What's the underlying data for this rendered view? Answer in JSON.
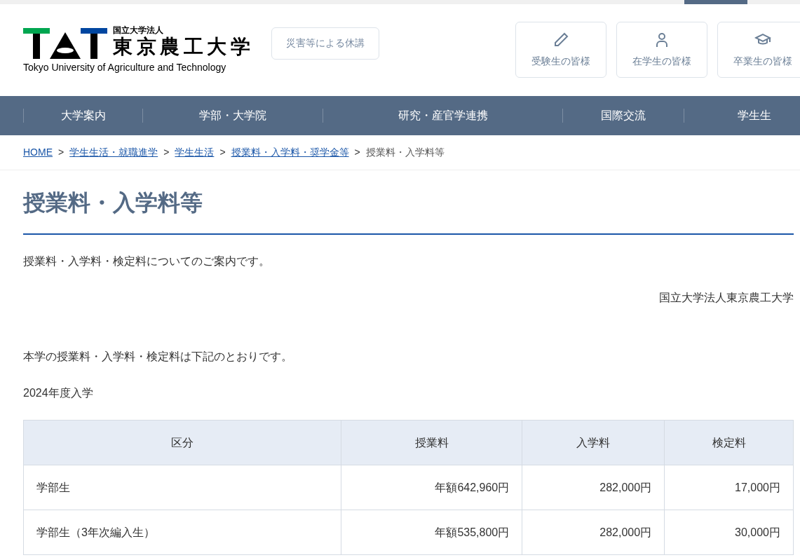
{
  "header": {
    "logo": {
      "org_type": "国立大学法人",
      "name": "東京農工大学",
      "name_en": "Tokyo University of Agriculture and Technology"
    },
    "notice_button": "災害等による休講",
    "audience_links": [
      {
        "kind": "pencil",
        "label": "受験生の皆様"
      },
      {
        "kind": "person",
        "label": "在学生の皆様"
      },
      {
        "kind": "cap",
        "label": "卒業生の皆様"
      }
    ]
  },
  "nav": {
    "items": [
      "大学案内",
      "学部・大学院",
      "研究・産官学連携",
      "国際交流",
      "学生生"
    ]
  },
  "breadcrumb": {
    "links": [
      {
        "label": "HOME",
        "separator": ">"
      },
      {
        "label": "学生生活・就職進学",
        "separator": ">"
      },
      {
        "label": "学生生活",
        "separator": ">"
      },
      {
        "label": "授業料・入学料・奨学金等",
        "separator": ">"
      }
    ],
    "current": "授業料・入学料等"
  },
  "page": {
    "title": "授業料・入学料等",
    "intro": "授業料・入学料・検定料についてのご案内です。",
    "signature": "国立大学法人東京農工大学",
    "lead": "本学の授業料・入学料・検定料は下記のとおりです。",
    "year_heading": "2024年度入学"
  },
  "table": {
    "columns": [
      "区分",
      "授業料",
      "入学料",
      "検定料"
    ],
    "rows": [
      [
        "学部生",
        "年額642,960円",
        "282,000円",
        "17,000円"
      ],
      [
        "学部生（3年次編入生）",
        "年額535,800円",
        "282,000円",
        "30,000円"
      ]
    ]
  }
}
